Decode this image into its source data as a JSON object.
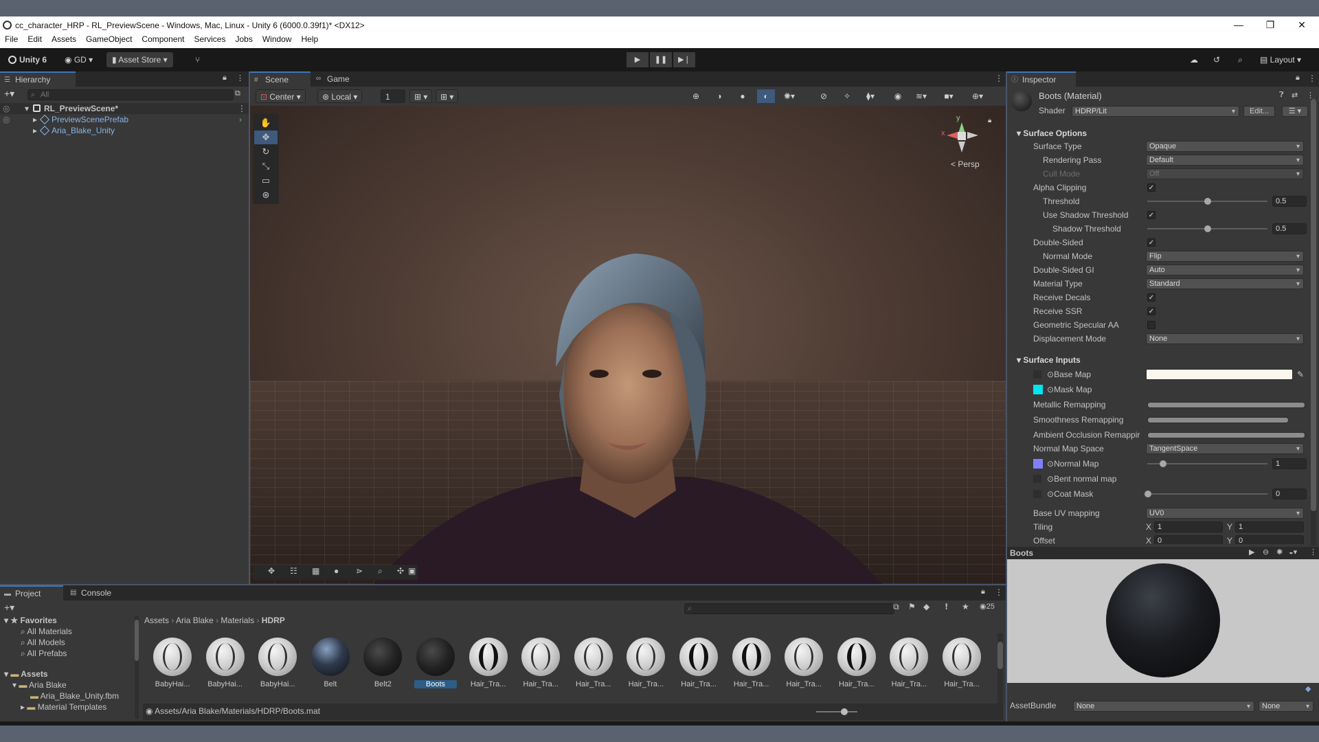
{
  "window": {
    "title": "cc_character_HRP - RL_PreviewScene - Windows, Mac, Linux - Unity 6 (6000.0.39f1)* <DX12>",
    "menus": [
      "File",
      "Edit",
      "Assets",
      "GameObject",
      "Component",
      "Services",
      "Jobs",
      "Window",
      "Help"
    ],
    "controls": {
      "minimize": "—",
      "restore": "❐",
      "close": "✕"
    }
  },
  "toolbar": {
    "unity_label": "Unity 6",
    "account_label": "GD",
    "asset_store_label": "Asset Store",
    "layout_label": "Layout",
    "play_icon": "▶",
    "pause_icon": "❚❚",
    "step_icon": "▶❘"
  },
  "hierarchy": {
    "tab": "Hierarchy",
    "search_placeholder": "All",
    "scene_name": "RL_PreviewScene*",
    "items": [
      "PreviewScenePrefab",
      "Aria_Blake_Unity"
    ]
  },
  "scene": {
    "tabs": [
      "Scene",
      "Game"
    ],
    "pivot": "Center",
    "space": "Local",
    "grid_size": "1",
    "persp_label": "< Persp",
    "gizmo_axes": {
      "x": "x",
      "y": "y"
    }
  },
  "inspector": {
    "tab": "Inspector",
    "object_name": "Boots (Material)",
    "shader_label": "Shader",
    "shader_value": "HDRP/Lit",
    "edit_button": "Edit...",
    "surface_options": {
      "header": "Surface Options",
      "rows": [
        {
          "label": "Surface Type",
          "kind": "dropdown",
          "value": "Opaque",
          "indent": 0
        },
        {
          "label": "Rendering Pass",
          "kind": "dropdown",
          "value": "Default",
          "indent": 1
        },
        {
          "label": "Cull Mode",
          "kind": "dropdown",
          "value": "Off",
          "indent": 1,
          "disabled": true
        },
        {
          "label": "Alpha Clipping",
          "kind": "check",
          "value": true,
          "indent": 0
        },
        {
          "label": "Threshold",
          "kind": "slider",
          "value": "0.5",
          "level": 0.5,
          "indent": 1
        },
        {
          "label": "Use Shadow Threshold",
          "kind": "check",
          "value": true,
          "indent": 1
        },
        {
          "label": "Shadow Threshold",
          "kind": "slider",
          "value": "0.5",
          "level": 0.5,
          "indent": 2
        },
        {
          "label": "Double-Sided",
          "kind": "check",
          "value": true,
          "indent": 0
        },
        {
          "label": "Normal Mode",
          "kind": "dropdown",
          "value": "Flip",
          "indent": 1
        },
        {
          "label": "Double-Sided GI",
          "kind": "dropdown",
          "value": "Auto",
          "indent": 0
        },
        {
          "label": "Material Type",
          "kind": "dropdown",
          "value": "Standard",
          "indent": 0
        },
        {
          "label": "Receive Decals",
          "kind": "check",
          "value": true,
          "indent": 0
        },
        {
          "label": "Receive SSR",
          "kind": "check",
          "value": true,
          "indent": 0
        },
        {
          "label": "Geometric Specular AA",
          "kind": "check",
          "value": false,
          "indent": 0
        },
        {
          "label": "Displacement Mode",
          "kind": "dropdown",
          "value": "None",
          "indent": 0
        }
      ]
    },
    "surface_inputs": {
      "header": "Surface Inputs",
      "base_map": "Base Map",
      "mask_map": "Mask Map",
      "metallic_remapping": "Metallic Remapping",
      "smoothness_remapping": "Smoothness Remapping",
      "ao_remapping": "Ambient Occlusion Remappir",
      "normal_map_space_label": "Normal Map Space",
      "normal_map_space_value": "TangentSpace",
      "normal_map": "Normal Map",
      "normal_map_value": "1",
      "bent_normal_map": "Bent normal map",
      "coat_mask": "Coat Mask",
      "coat_mask_value": "0",
      "base_uv_label": "Base UV mapping",
      "base_uv_value": "UV0",
      "tiling_label": "Tiling",
      "offset_label": "Offset",
      "x_label": "X",
      "y_label": "Y",
      "tiling_x": "1",
      "tiling_y": "1",
      "offset_x": "0",
      "offset_y": "0"
    },
    "colors": {
      "mask_map_swatch": "#00e5f0",
      "normal_map_swatch": "#8080ff",
      "base_map_color": "#fbf6ee"
    }
  },
  "preview": {
    "title": "Boots",
    "assetbundle_label": "AssetBundle",
    "assetbundle_value": "None",
    "variant_value": "None"
  },
  "project": {
    "tabs": [
      "Project",
      "Console"
    ],
    "count": "25",
    "breadcrumb": [
      "Assets",
      "Aria Blake",
      "Materials",
      "HDRP"
    ],
    "favorites": {
      "header": "Favorites",
      "items": [
        "All Materials",
        "All Models",
        "All Prefabs"
      ]
    },
    "assets": {
      "header": "Assets",
      "items": [
        "Aria Blake",
        "Aria_Blake_Unity.fbm",
        "Material Templates"
      ]
    },
    "materials": [
      {
        "name": "BabyHai...",
        "style": "hair"
      },
      {
        "name": "BabyHai...",
        "style": "hair"
      },
      {
        "name": "BabyHai...",
        "style": "hair"
      },
      {
        "name": "Belt",
        "style": "belt"
      },
      {
        "name": "Belt2",
        "style": "dark"
      },
      {
        "name": "Boots",
        "style": "dark",
        "selected": true
      },
      {
        "name": "Hair_Tra...",
        "style": "hairdark"
      },
      {
        "name": "Hair_Tra...",
        "style": "hair"
      },
      {
        "name": "Hair_Tra...",
        "style": "hair"
      },
      {
        "name": "Hair_Tra...",
        "style": "hair"
      },
      {
        "name": "Hair_Tra...",
        "style": "hairdark"
      },
      {
        "name": "Hair_Tra...",
        "style": "hairdark"
      },
      {
        "name": "Hair_Tra...",
        "style": "hair"
      },
      {
        "name": "Hair_Tra...",
        "style": "hairdark"
      },
      {
        "name": "Hair_Tra...",
        "style": "hair"
      },
      {
        "name": "Hair_Tra...",
        "style": "hair"
      }
    ],
    "path": "Assets/Aria Blake/Materials/HDRP/Boots.mat"
  }
}
